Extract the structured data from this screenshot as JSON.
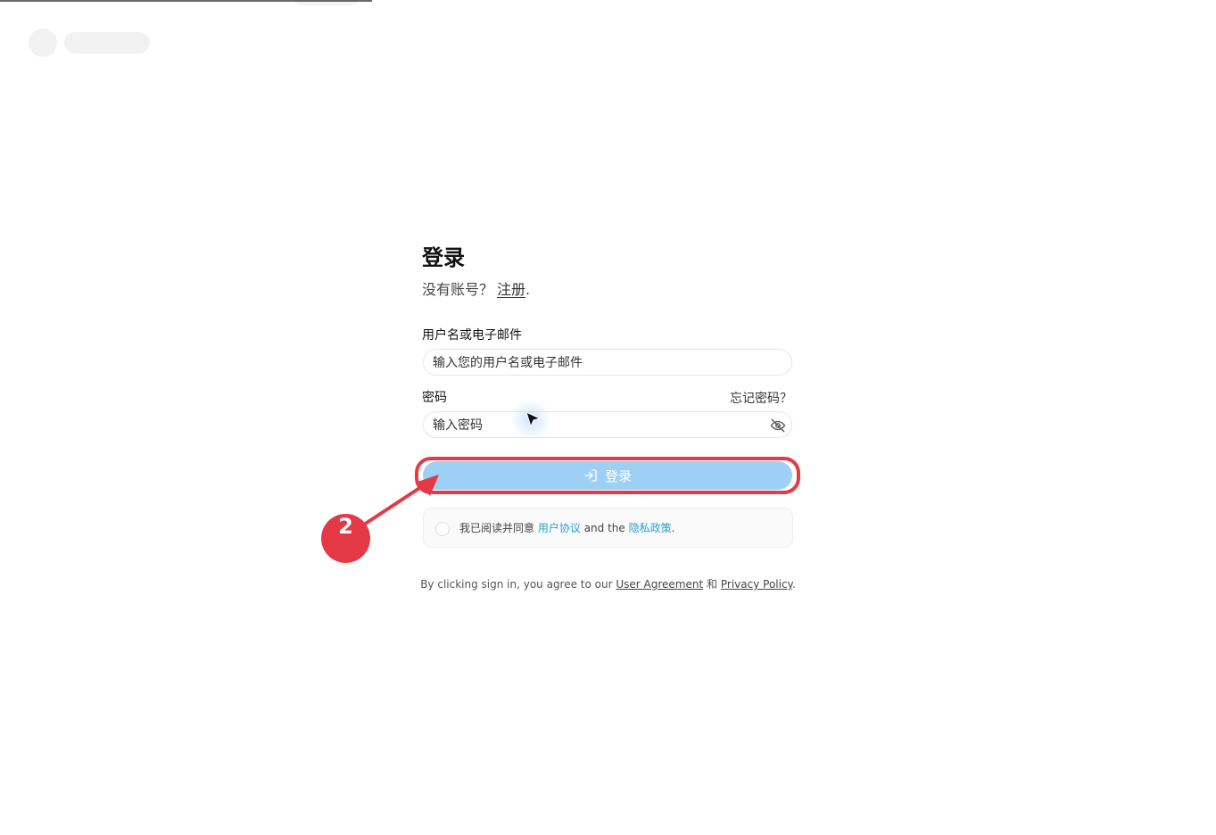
{
  "page": {
    "title": "登录",
    "no_account_prompt": "没有账号？",
    "register_link": "注册",
    "register_punct": "."
  },
  "form": {
    "username_label": "用户名或电子邮件",
    "username_placeholder": "输入您的用户名或电子邮件",
    "password_label": "密码",
    "forgot_link": "忘记密码？",
    "password_placeholder": "输入密码",
    "password_toggle_icon": "eye-off-icon",
    "submit_label": "登录",
    "submit_icon": "sign-in-icon"
  },
  "agreement": {
    "prefix": "我已阅读并同意",
    "user_agreement": "用户协议",
    "and_text": "and the",
    "privacy_policy": "隐私政策",
    "suffix": "."
  },
  "footer": {
    "prefix": "By clicking sign in, you agree to our",
    "user_agreement": "User Agreement",
    "and_text": "和",
    "privacy_policy": "Privacy Policy",
    "suffix": "."
  },
  "annotation": {
    "step_number": "2",
    "color": "#e53945"
  },
  "colors": {
    "button_bg": "#9ed0f5",
    "link": "#2a9fd6"
  }
}
